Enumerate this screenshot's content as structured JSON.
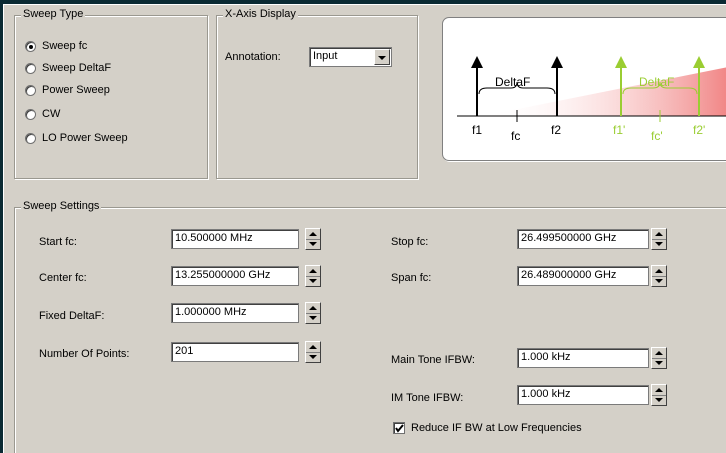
{
  "sweep_type": {
    "legend": "Sweep Type",
    "options": [
      "Sweep fc",
      "Sweep DeltaF",
      "Power Sweep",
      "CW",
      "LO Power Sweep"
    ],
    "selected": "Sweep fc"
  },
  "x_axis_display": {
    "legend": "X-Axis Display",
    "annotation_label": "Annotation:",
    "annotation_value": "Input"
  },
  "diagram": {
    "deltaf_label": "DeltaF",
    "deltaf_label_output": "DeltaF",
    "f1": "f1",
    "fc": "fc",
    "f2": "f2",
    "f1_prime": "f1'",
    "fc_prime": "fc'",
    "f2_prime": "f2'",
    "input_color": "#000000",
    "output_color": "#9acd32",
    "ramp_color": "#f08080"
  },
  "sweep_settings": {
    "legend": "Sweep Settings",
    "start_fc_label": "Start fc:",
    "start_fc_value": "10.500000 MHz",
    "center_fc_label": "Center fc:",
    "center_fc_value": "13.255000000 GHz",
    "fixed_deltaf_label": "Fixed DeltaF:",
    "fixed_deltaf_value": "1.000000 MHz",
    "num_points_label": "Number Of Points:",
    "num_points_value": "201",
    "stop_fc_label": "Stop fc:",
    "stop_fc_value": "26.499500000 GHz",
    "span_fc_label": "Span fc:",
    "span_fc_value": "26.489000000 GHz",
    "main_tone_label": "Main Tone IFBW:",
    "main_tone_value": "1.000 kHz",
    "im_tone_label": "IM Tone IFBW:",
    "im_tone_value": "1.000 kHz",
    "reduce_ifbw_label": "Reduce IF BW at Low Frequencies",
    "reduce_ifbw_checked": true
  }
}
